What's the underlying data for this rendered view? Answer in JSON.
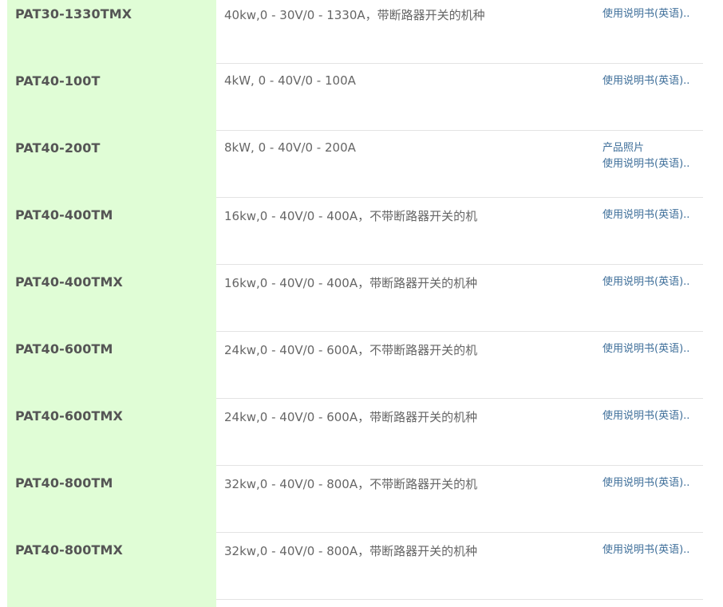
{
  "rows": [
    {
      "model": "PAT30-1330TMX",
      "desc": "40kw,0 - 30V/0 - 1330A，带断路器开关的机种",
      "links": [
        "使用说明书(英语).."
      ]
    },
    {
      "model": "PAT40-100T",
      "desc": "4kW, 0 - 40V/0 - 100A",
      "links": [
        "使用说明书(英语).."
      ]
    },
    {
      "model": "PAT40-200T",
      "desc": "8kW, 0 - 40V/0 - 200A",
      "links": [
        "产品照片",
        "使用说明书(英语).."
      ]
    },
    {
      "model": "PAT40-400TM",
      "desc": "16kw,0 - 40V/0 - 400A，不带断路器开关的机",
      "links": [
        "使用说明书(英语).."
      ]
    },
    {
      "model": "PAT40-400TMX",
      "desc": "16kw,0 - 40V/0 - 400A，带断路器开关的机种",
      "links": [
        "使用说明书(英语).."
      ]
    },
    {
      "model": "PAT40-600TM",
      "desc": "24kw,0 - 40V/0 - 600A，不带断路器开关的机",
      "links": [
        "使用说明书(英语).."
      ]
    },
    {
      "model": "PAT40-600TMX",
      "desc": "24kw,0 - 40V/0 - 600A，带断路器开关的机种",
      "links": [
        "使用说明书(英语).."
      ]
    },
    {
      "model": "PAT40-800TM",
      "desc": "32kw,0 - 40V/0 - 800A，不带断路器开关的机",
      "links": [
        "使用说明书(英语).."
      ]
    },
    {
      "model": "PAT40-800TMX",
      "desc": "32kw,0 - 40V/0 - 800A，带断路器开关的机种",
      "links": [
        "使用说明书(英语).."
      ]
    }
  ],
  "colors": {
    "model_column_bg": "#e0fdd6",
    "link": "#3f6f9a",
    "model_text": "#555555",
    "desc_text": "#666666"
  }
}
